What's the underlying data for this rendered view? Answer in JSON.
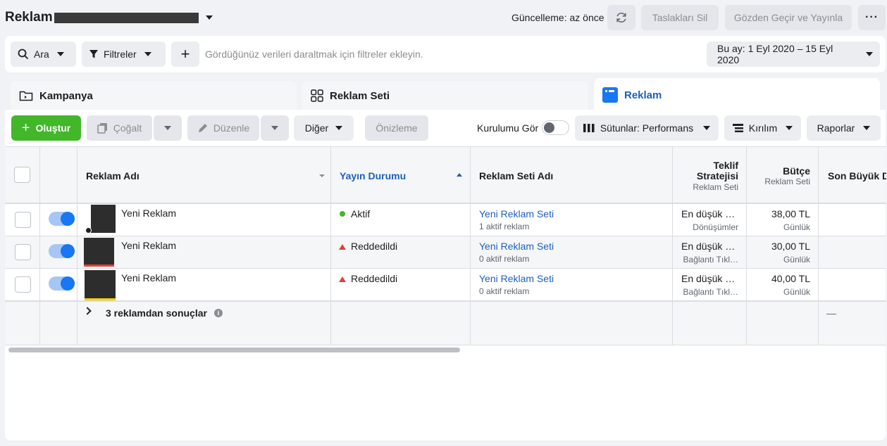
{
  "header": {
    "title": "Reklam",
    "update_status": "Güncelleme: az önce",
    "delete_drafts": "Taslakları Sil",
    "review_publish": "Gözden Geçir ve Yayınla",
    "more": "···"
  },
  "filter_bar": {
    "search": "Ara",
    "filters": "Filtreler",
    "add": "+",
    "hint": "Gördüğünüz verileri daraltmak için filtreler ekleyin.",
    "date_range": "Bu ay: 1 Eyl 2020 – 15 Eyl 2020"
  },
  "tabs": {
    "campaign": "Kampanya",
    "adset": "Reklam Seti",
    "ad": "Reklam"
  },
  "toolbar": {
    "create": "Oluştur",
    "duplicate": "Çoğalt",
    "edit": "Düzenle",
    "other": "Diğer",
    "preview": "Önizleme",
    "setup_view": "Kurulumu Gör",
    "columns": "Sütunlar: Performans",
    "breakdown": "Kırılım",
    "reports": "Raporlar"
  },
  "table": {
    "headers": {
      "ad_name": "Reklam Adı",
      "delivery": "Yayın Durumu",
      "adset_name": "Reklam Seti Adı",
      "bid_line1": "Teklif",
      "bid_line2": "Stratejisi",
      "bid_sub": "Reklam Seti",
      "budget": "Bütçe",
      "budget_sub": "Reklam Seti",
      "last_edit": "Son Büyük D"
    },
    "rows": [
      {
        "name": "Yeni Reklam",
        "status": "Aktif",
        "status_color": "#42b72a",
        "adset": "Yeni Reklam Seti",
        "adset_sub": "1 aktif reklam",
        "bid": "En düşük …",
        "bid_sub": "Dönüşümler",
        "budget": "38,00 TL",
        "budget_sub": "Günlük"
      },
      {
        "name": "Yeni Reklam",
        "status": "Reddedildi",
        "status_color": "#e0413a",
        "adset": "Yeni Reklam Seti",
        "adset_sub": "0 aktif reklam",
        "bid": "En düşük …",
        "bid_sub": "Bağlantı Tıkl…",
        "budget": "30,00 TL",
        "budget_sub": "Günlük"
      },
      {
        "name": "Yeni Reklam",
        "status": "Reddedildi",
        "status_color": "#e0413a",
        "adset": "Yeni Reklam Seti",
        "adset_sub": "0 aktif reklam",
        "bid": "En düşük …",
        "bid_sub": "Bağlantı Tıkl…",
        "budget": "40,00 TL",
        "budget_sub": "Günlük"
      }
    ],
    "summary": {
      "label": "3 reklamdan sonuçlar",
      "last_col": "—"
    }
  }
}
